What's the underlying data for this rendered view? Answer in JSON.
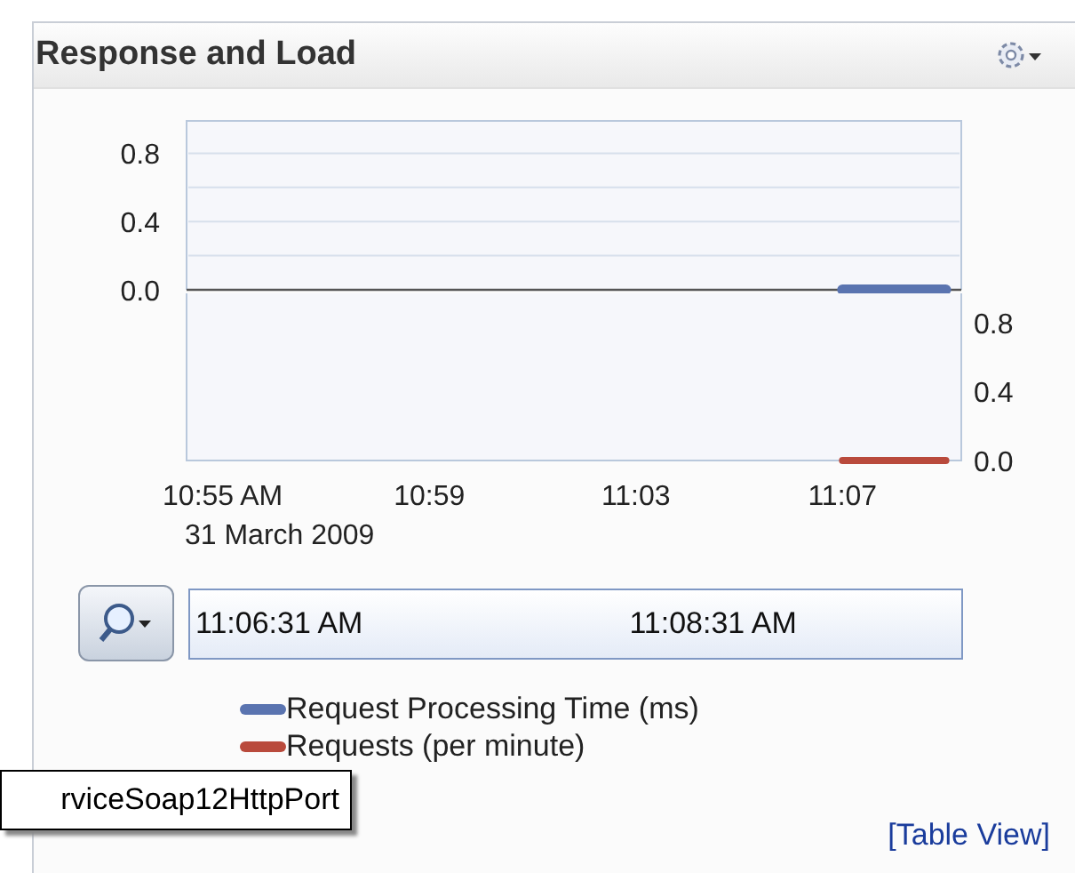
{
  "panel": {
    "title": "Response and Load"
  },
  "chart": {
    "upper": {
      "chart_data": {
        "type": "line",
        "ylim": [
          0,
          0.99
        ],
        "yticks": [
          {
            "value": 0.8,
            "label": "0.8"
          },
          {
            "value": 0.4,
            "label": "0.4"
          },
          {
            "value": 0,
            "label": "0.0"
          }
        ],
        "series": [
          {
            "name": "Request Processing Time (ms)",
            "color": "#5a74b0",
            "values": [
              null,
              null,
              null,
              null,
              null,
              null,
              null,
              null,
              null,
              null,
              null,
              null,
              0,
              0,
              0
            ]
          }
        ]
      }
    },
    "lower": {
      "chart_data": {
        "type": "line",
        "ylim": [
          0,
          0.97
        ],
        "categories": [
          "10:55 AM",
          null,
          null,
          null,
          "10:59",
          null,
          null,
          null,
          "11:03",
          null,
          null,
          null,
          "11:07",
          null,
          null
        ],
        "yticks": [
          {
            "value": 0.8,
            "label": "0.8"
          },
          {
            "value": 0.4,
            "label": "0.4"
          },
          {
            "value": 0,
            "label": "0.0"
          }
        ],
        "series": [
          {
            "name": "Requests (per minute)",
            "color": "#b94a3c",
            "values": [
              null,
              null,
              null,
              null,
              null,
              null,
              null,
              null,
              null,
              null,
              null,
              null,
              0,
              0,
              0
            ]
          }
        ]
      }
    },
    "date_label": "31 March 2009"
  },
  "time_range": {
    "start": "11:06:31 AM",
    "end": "11:08:31 AM"
  },
  "tooltip": "rviceSoap12HttpPort",
  "table_view_link": "[Table View]"
}
